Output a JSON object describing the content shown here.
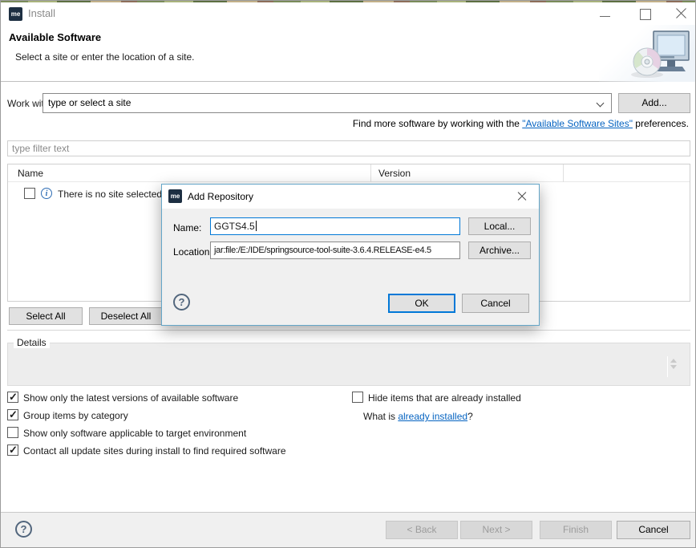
{
  "window": {
    "icon_text": "me",
    "title": "Install"
  },
  "header": {
    "title": "Available Software",
    "subtitle": "Select a site or enter the location of a site."
  },
  "work_with": {
    "label": "Work with:",
    "combo_value": "type or select a site",
    "add_button": "Add...",
    "hint_prefix": "Find more software by working with the ",
    "hint_link": "\"Available Software Sites\"",
    "hint_suffix": " preferences."
  },
  "filter": {
    "placeholder": "type filter text"
  },
  "table": {
    "columns": [
      "Name",
      "Version"
    ],
    "empty_row": "There is no site selected."
  },
  "selection": {
    "select_all": "Select All",
    "deselect_all": "Deselect All"
  },
  "details": {
    "label": "Details"
  },
  "options": {
    "left": [
      {
        "label": "Show only the latest versions of available software",
        "checked": true
      },
      {
        "label": "Group items by category",
        "checked": true
      },
      {
        "label": "Show only software applicable to target environment",
        "checked": false
      },
      {
        "label": "Contact all update sites during install to find required software",
        "checked": true
      }
    ],
    "right": [
      {
        "label": "Hide items that are already installed",
        "checked": false
      }
    ],
    "what_is_prefix": "What is ",
    "what_is_link": "already installed",
    "what_is_suffix": "?"
  },
  "dialog": {
    "icon_text": "me",
    "title": "Add Repository",
    "name_label": "Name:",
    "name_value": "GGTS4.5",
    "location_label": "Location:",
    "location_value": "jar:file:/E:/IDE/springsource-tool-suite-3.6.4.RELEASE-e4.5",
    "local_button": "Local...",
    "archive_button": "Archive...",
    "ok_button": "OK",
    "cancel_button": "Cancel"
  },
  "footer": {
    "back": "< Back",
    "next": "Next >",
    "finish": "Finish",
    "cancel": "Cancel"
  },
  "icons": {
    "info": "i",
    "help": "?"
  },
  "colors": {
    "accent_blue": "#0078d7",
    "dialog_border": "#64a6c8",
    "link_blue": "#0563c1",
    "app_icon_navy": "#1d2f42"
  }
}
